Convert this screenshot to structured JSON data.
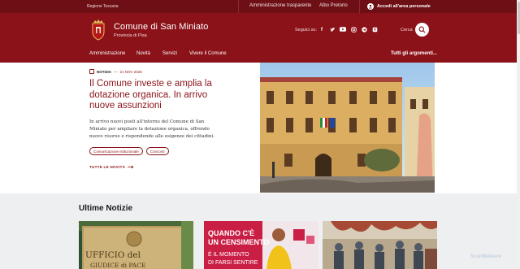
{
  "topbar": {
    "region": "Regione Toscana",
    "links": [
      "Amministrazione trasparente",
      "Albo Pretorio"
    ],
    "login": "Accedi all'area personale"
  },
  "header": {
    "title": "Comune di San Miniato",
    "subtitle": "Provincia di Pisa",
    "follow_label": "Seguici su:",
    "socials": [
      "facebook-icon",
      "twitter-icon",
      "youtube-icon",
      "instagram-icon",
      "telegram-icon",
      "podcast-icon"
    ],
    "search_label": "Cerca"
  },
  "nav": {
    "items": [
      "Amministrazione",
      "Novità",
      "Servizi",
      "Vivere il Comune"
    ],
    "all_topics": "Tutti gli argomenti..."
  },
  "hero": {
    "tag": "NOTIZIA",
    "date": "21 NOV 2025",
    "headline": "Il Comune investe e amplia la dotazione organica. In arrivo nuove assunzioni",
    "lead": "In arrivo nuovi posti all'interno del Comune di San Miniato per ampliare la dotazione organica, offrendo nuove risorse e rispondendo alle esigenze dei cittadini.",
    "chips": [
      "Comunicazione istituzionale",
      "Concorsi"
    ],
    "all_news": "TUTTE LE NOVITÀ"
  },
  "latest": {
    "title": "Ultime Notizie",
    "card1_sign": [
      "UFFICIO del",
      "GIUDICE di PACE"
    ],
    "card2_text": [
      "QUANDO C'È",
      "UN CENSIMENTO",
      "È IL MOMENTO",
      "DI FARSI SENTIRE"
    ]
  },
  "watermark": "ScanMalware",
  "colors": {
    "brand": "#8a1218",
    "topbar": "#6d0f14",
    "band": "#eeeff1"
  }
}
